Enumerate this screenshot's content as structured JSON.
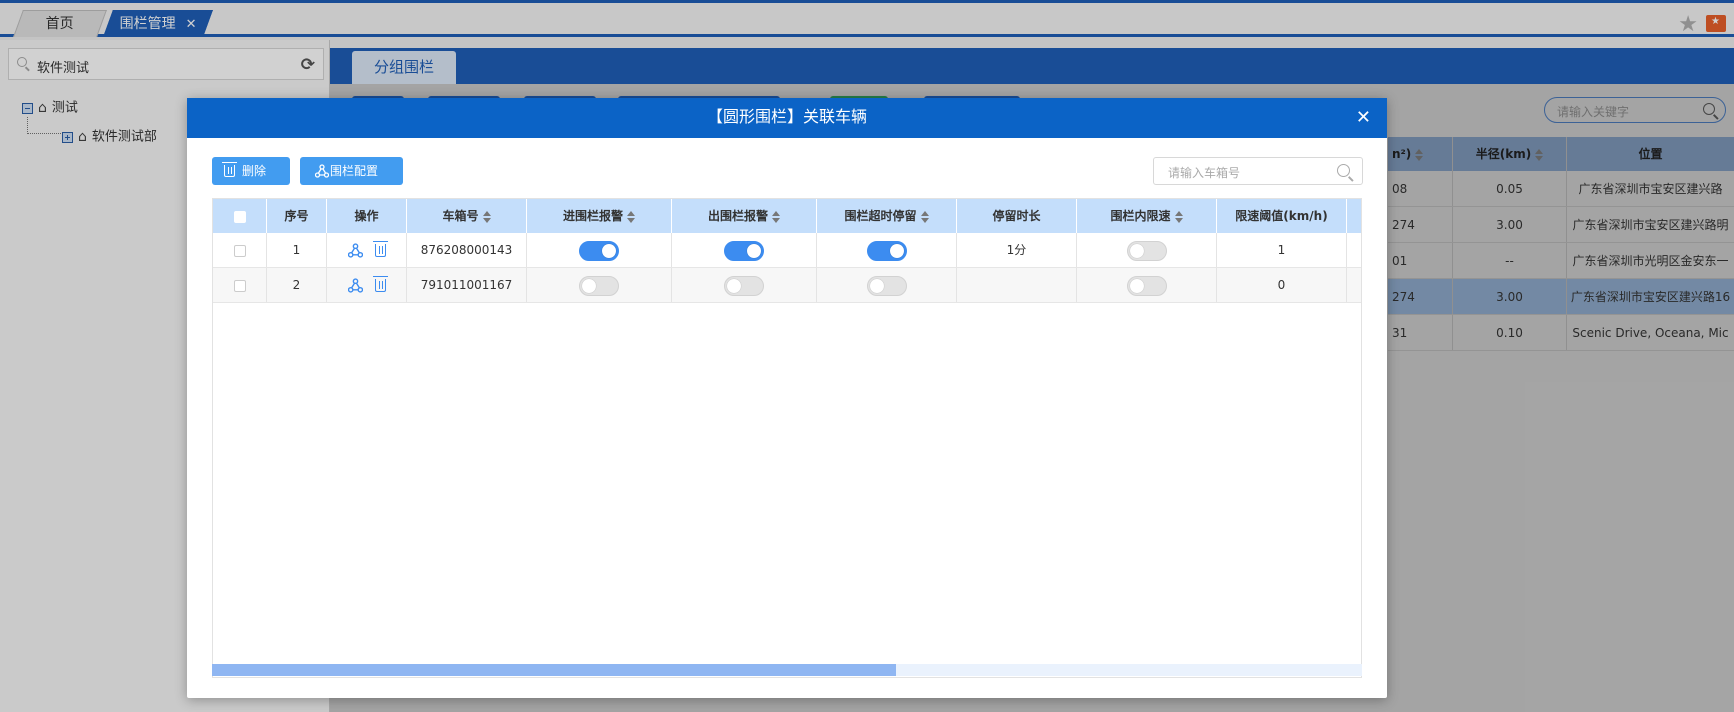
{
  "tabs": [
    {
      "label": "首页"
    },
    {
      "label": "围栏管理",
      "close": "✕"
    }
  ],
  "left": {
    "search_value": "软件测试",
    "tree": {
      "root": "测试",
      "child": "软件测试部"
    }
  },
  "main": {
    "subtab": "分组围栏",
    "search_placeholder": "请输入关键字",
    "bg_table": {
      "headers": [
        "n²)",
        "半径(km)",
        "位置"
      ],
      "rows": [
        {
          "c1": "08",
          "c2": "0.05",
          "c3": "广东省深圳市宝安区建兴路"
        },
        {
          "c1": "274",
          "c2": "3.00",
          "c3": "广东省深圳市宝安区建兴路明"
        },
        {
          "c1": "01",
          "c2": "--",
          "c3": "广东省深圳市光明区金安东一"
        },
        {
          "c1": "274",
          "c2": "3.00",
          "c3": "广东省深圳市宝安区建兴路16"
        },
        {
          "c1": "31",
          "c2": "0.10",
          "c3": "Scenic Drive, Oceana, Mic"
        }
      ]
    }
  },
  "modal": {
    "title": "【圆形围栏】关联车辆",
    "close": "✕",
    "delete_label": "删除",
    "config_label": "围栏配置",
    "search_placeholder": "请输入车箱号",
    "headers": [
      "序号",
      "操作",
      "车箱号",
      "进围栏报警",
      "出围栏报警",
      "围栏超时停留",
      "停留时长",
      "围栏内限速",
      "限速阈值(km/h)"
    ],
    "rows": [
      {
        "index": "1",
        "vehicle": "876208000143",
        "enter_alarm": true,
        "exit_alarm": true,
        "overstay": true,
        "stay_duration": "1分",
        "speed_limit": false,
        "threshold": "1"
      },
      {
        "index": "2",
        "vehicle": "791011001167",
        "enter_alarm": false,
        "exit_alarm": false,
        "overstay": false,
        "stay_duration": "",
        "speed_limit": false,
        "threshold": "0"
      }
    ],
    "scroll_fraction": 0.595
  },
  "colors": {
    "primary": "#0b63c6",
    "accent": "#3c8cf0",
    "header_bg": "#c4defb"
  },
  "icons": [
    "star-icon",
    "folder-icon",
    "refresh-icon",
    "search-icon",
    "home-icon",
    "close-icon",
    "trash-icon",
    "fence-config-icon",
    "sort-icon"
  ]
}
